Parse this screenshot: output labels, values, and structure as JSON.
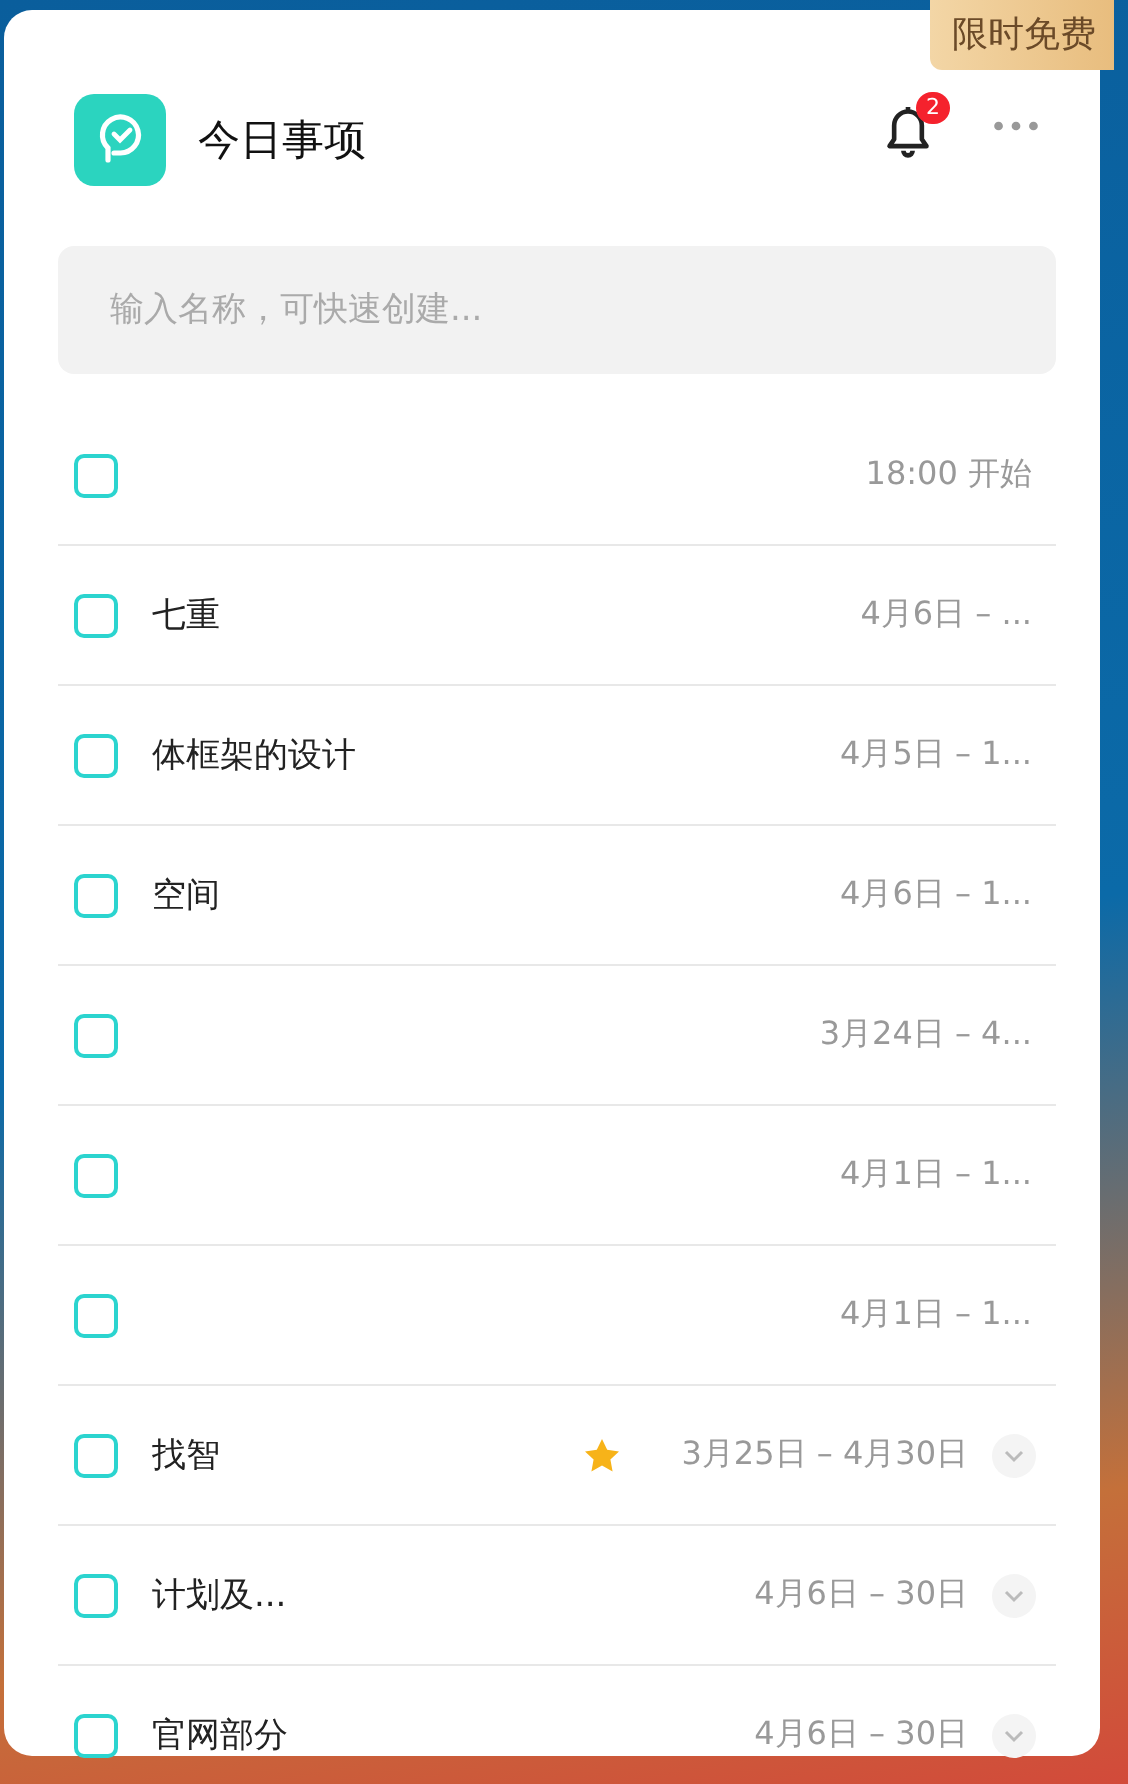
{
  "promo_badge": "限时免费",
  "header": {
    "title": "今日事项",
    "notification_count": "2"
  },
  "search": {
    "placeholder": "输入名称，可快速创建..."
  },
  "tasks": [
    {
      "checked": false,
      "date": "18:00 开始",
      "starred": false,
      "expandable": false
    },
    {
      "title": "七重",
      "checked": false,
      "date": "4月6日 – ...",
      "starred": false,
      "expandable": false
    },
    {
      "title": "体框架的设计",
      "checked": false,
      "date": "4月5日 – 1...",
      "starred": false,
      "expandable": false
    },
    {
      "title": "空间",
      "checked": false,
      "date": "4月6日 – 1...",
      "starred": false,
      "expandable": false
    },
    {
      "checked": false,
      "date": "3月24日 – 4...",
      "starred": false,
      "expandable": false
    },
    {
      "checked": false,
      "date": "4月1日 – 1...",
      "starred": false,
      "expandable": false
    },
    {
      "checked": false,
      "date": "4月1日 – 1...",
      "starred": false,
      "expandable": false
    },
    {
      "title": "找智",
      "checked": false,
      "date": "3月25日 – 4月30日",
      "starred": true,
      "expandable": true
    },
    {
      "title": "计划及...",
      "checked": false,
      "date": "4月6日 – 30日",
      "starred": false,
      "expandable": true
    },
    {
      "title": "官网部分",
      "checked": false,
      "date": "4月6日 – 30日",
      "starred": false,
      "expandable": true
    }
  ]
}
